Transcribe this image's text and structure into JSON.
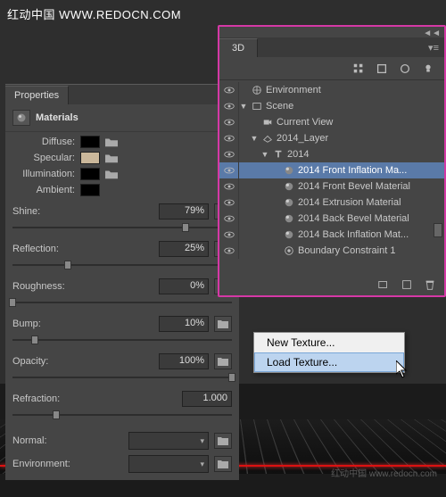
{
  "watermark": "红动中国 WWW.REDOCN.COM",
  "mini_watermark": "红动中国 www.redocn.com",
  "properties": {
    "tab": "Properties",
    "section": "Materials",
    "colors": {
      "diffuse_label": "Diffuse:",
      "diffuse_hex": "#000000",
      "specular_label": "Specular:",
      "specular_hex": "#cbb89b",
      "illumination_label": "Illumination:",
      "illumination_hex": "#000000",
      "ambient_label": "Ambient:",
      "ambient_hex": "#000000"
    },
    "sliders": {
      "shine": {
        "label": "Shine:",
        "value": "79%",
        "pos": 0.79
      },
      "reflection": {
        "label": "Reflection:",
        "value": "25%",
        "pos": 0.25
      },
      "roughness": {
        "label": "Roughness:",
        "value": "0%",
        "pos": 0.0
      },
      "bump": {
        "label": "Bump:",
        "value": "10%",
        "pos": 0.1
      },
      "opacity": {
        "label": "Opacity:",
        "value": "100%",
        "pos": 1.0
      },
      "refraction": {
        "label": "Refraction:",
        "value": "1.000",
        "pos": 0.2
      }
    },
    "maps": {
      "normal_label": "Normal:",
      "environment_label": "Environment:"
    }
  },
  "panel3d": {
    "tab": "3D",
    "tree": [
      {
        "label": "Environment",
        "indent": 0,
        "twisty": "",
        "icon": "env"
      },
      {
        "label": "Scene",
        "indent": 0,
        "twisty": "▼",
        "icon": "scene"
      },
      {
        "label": "Current View",
        "indent": 1,
        "twisty": "",
        "icon": "camera"
      },
      {
        "label": "2014_Layer",
        "indent": 1,
        "twisty": "▼",
        "icon": "mesh"
      },
      {
        "label": "2014",
        "indent": 2,
        "twisty": "▼",
        "icon": "text3d"
      },
      {
        "label": "2014 Front Inflation Ma...",
        "indent": 3,
        "icon": "mat",
        "selected": true
      },
      {
        "label": "2014 Front Bevel Material",
        "indent": 3,
        "icon": "mat"
      },
      {
        "label": "2014 Extrusion Material",
        "indent": 3,
        "icon": "mat"
      },
      {
        "label": "2014 Back Bevel Material",
        "indent": 3,
        "icon": "mat"
      },
      {
        "label": "2014 Back Inflation Mat...",
        "indent": 3,
        "icon": "mat"
      },
      {
        "label": "Boundary Constraint 1",
        "indent": 3,
        "icon": "constraint"
      }
    ]
  },
  "context_menu": {
    "items": [
      {
        "label": "New Texture..."
      },
      {
        "label": "Load Texture...",
        "hover": true
      }
    ]
  }
}
